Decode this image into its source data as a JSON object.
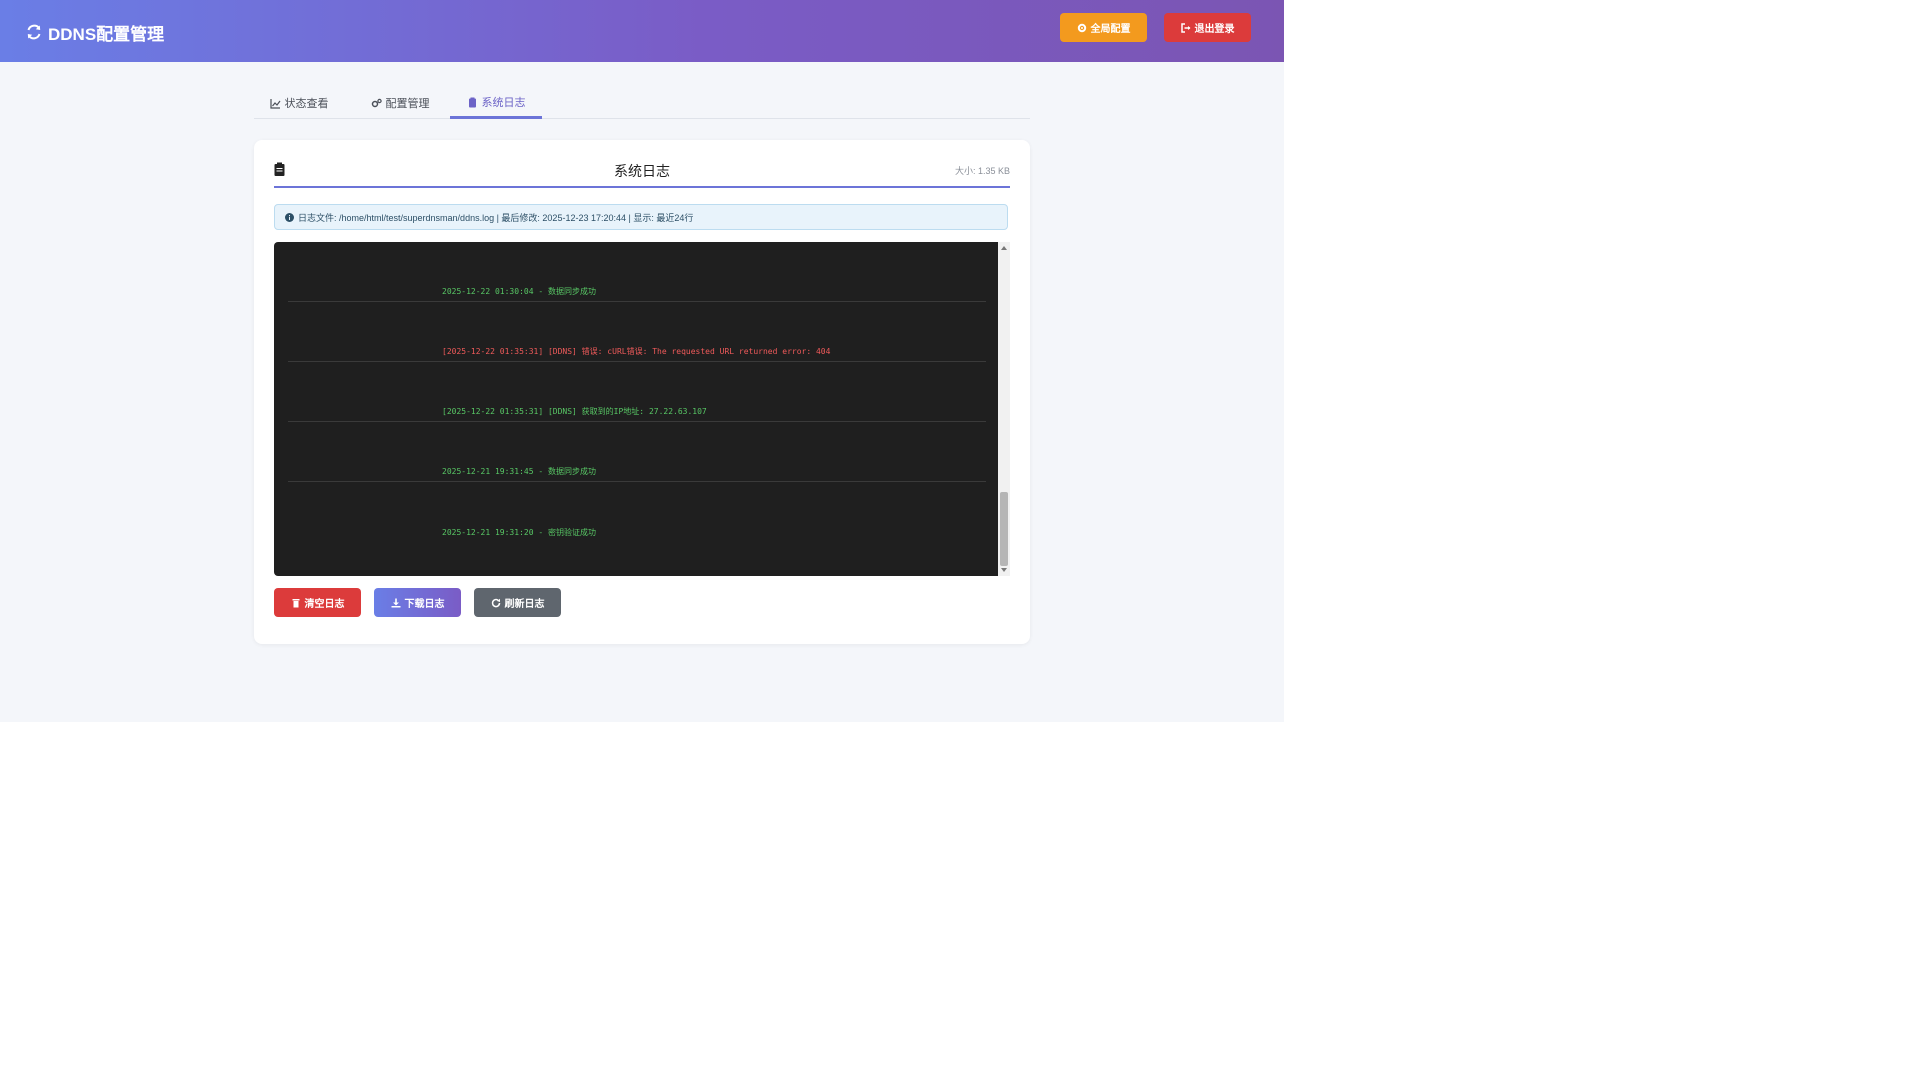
{
  "header": {
    "app_title": "DDNS配置管理",
    "brand_icon": "sync-icon",
    "config_button": "全局配置",
    "logout_button": "退出登录",
    "colors": {
      "gradient_start": "#6a7ee6",
      "gradient_end": "#7b55b3",
      "config_button": "#f39a1e",
      "logout_button": "#dc3b3b"
    }
  },
  "tabs": [
    {
      "label": "状态查看",
      "icon": "chart-line-icon",
      "active": false
    },
    {
      "label": "配置管理",
      "icon": "cogs-icon",
      "active": false
    },
    {
      "label": "系统日志",
      "icon": "clipboard-icon",
      "active": true
    }
  ],
  "log_panel": {
    "title": "系统日志",
    "size_label": "大小: 1.35 KB",
    "info_text": "日志文件: /home/html/test/superdnsman/ddns.log | 最后修改: 2025-12-23 17:20:44 | 显示: 最近24行",
    "lines": [
      {
        "text": "2025-12-22 01:30:04 - 数据同步成功",
        "level": "ok"
      },
      {
        "text": "[2025-12-22 01:35:31] [DDNS] 错误: cURL错误: The requested URL returned error: 404",
        "level": "err"
      },
      {
        "text": "[2025-12-22 01:35:31] [DDNS] 获取到的IP地址: 27.22.63.107",
        "level": "ok"
      },
      {
        "text": "2025-12-21 19:31:45 - 数据同步成功",
        "level": "ok"
      },
      {
        "text": "2025-12-21 19:31:20 - 密钥验证成功",
        "level": "ok"
      }
    ],
    "colors": {
      "ok": "#58c765",
      "err": "#ef5a5a",
      "terminal_bg": "#1f1f1f"
    }
  },
  "actions": {
    "clear_button": "清空日志",
    "download_button": "下载日志",
    "refresh_button": "刷新日志"
  }
}
